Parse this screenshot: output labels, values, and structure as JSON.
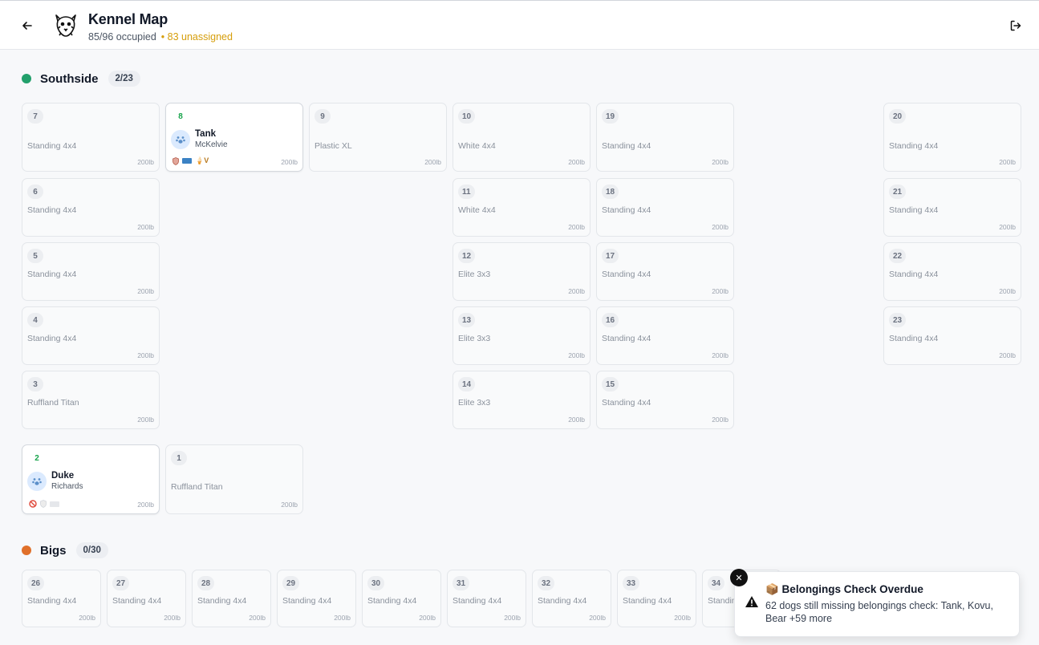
{
  "header": {
    "title": "Kennel Map",
    "occupied": "85/96 occupied",
    "unassigned": "• 83 unassigned"
  },
  "colors": {
    "southside": "#22a06b",
    "bigs": "#e0702a",
    "warning": "#d69e0b"
  },
  "sections": {
    "southside": {
      "title": "Southside",
      "count": "2/23",
      "kennels": [
        {
          "num": "7",
          "type": "Standing 4x4",
          "cap": "200lb"
        },
        {
          "num": "8",
          "type": "",
          "cap": "200lb",
          "dog": "Tank",
          "owner": "McKelvie"
        },
        {
          "num": "9",
          "type": "Plastic XL",
          "cap": "200lb"
        },
        {
          "num": "10",
          "type": "White 4x4",
          "cap": "200lb"
        },
        {
          "num": "19",
          "type": "Standing 4x4",
          "cap": "200lb"
        },
        {
          "num": "20",
          "type": "Standing 4x4",
          "cap": "200lb"
        },
        {
          "num": "6",
          "type": "Standing 4x4",
          "cap": "200lb"
        },
        {
          "num": "11",
          "type": "White 4x4",
          "cap": "200lb"
        },
        {
          "num": "18",
          "type": "Standing 4x4",
          "cap": "200lb"
        },
        {
          "num": "21",
          "type": "Standing 4x4",
          "cap": "200lb"
        },
        {
          "num": "5",
          "type": "Standing 4x4",
          "cap": "200lb"
        },
        {
          "num": "12",
          "type": "Elite 3x3",
          "cap": "200lb"
        },
        {
          "num": "17",
          "type": "Standing 4x4",
          "cap": "200lb"
        },
        {
          "num": "22",
          "type": "Standing 4x4",
          "cap": "200lb"
        },
        {
          "num": "4",
          "type": "Standing 4x4",
          "cap": "200lb"
        },
        {
          "num": "13",
          "type": "Elite 3x3",
          "cap": "200lb"
        },
        {
          "num": "16",
          "type": "Standing 4x4",
          "cap": "200lb"
        },
        {
          "num": "23",
          "type": "Standing 4x4",
          "cap": "200lb"
        },
        {
          "num": "3",
          "type": "Ruffland Titan",
          "cap": "200lb"
        },
        {
          "num": "14",
          "type": "Elite 3x3",
          "cap": "200lb"
        },
        {
          "num": "15",
          "type": "Standing 4x4",
          "cap": "200lb"
        },
        {
          "num": "2",
          "type": "",
          "cap": "200lb",
          "dog": "Duke",
          "owner": "Richards"
        },
        {
          "num": "1",
          "type": "Ruffland Titan",
          "cap": "200lb"
        }
      ]
    },
    "bigs": {
      "title": "Bigs",
      "count": "0/30",
      "kennels": [
        {
          "num": "26",
          "type": "Standing 4x4",
          "cap": "200lb"
        },
        {
          "num": "27",
          "type": "Standing 4x4",
          "cap": "200lb"
        },
        {
          "num": "28",
          "type": "Standing 4x4",
          "cap": "200lb"
        },
        {
          "num": "29",
          "type": "Standing 4x4",
          "cap": "200lb"
        },
        {
          "num": "30",
          "type": "Standing 4x4",
          "cap": "200lb"
        },
        {
          "num": "31",
          "type": "Standing 4x4",
          "cap": "200lb"
        },
        {
          "num": "32",
          "type": "Standing 4x4",
          "cap": "200lb"
        },
        {
          "num": "33",
          "type": "Standing 4x4",
          "cap": "200lb"
        },
        {
          "num": "34",
          "type": "Standin",
          "cap": ""
        }
      ]
    }
  },
  "badges": {
    "tank_vaccine": "V"
  },
  "toast": {
    "title": "📦 Belongings Check Overdue",
    "message": "62 dogs still missing belongings check: Tank, Kovu, Bear +59 more",
    "close_label": "✕"
  }
}
